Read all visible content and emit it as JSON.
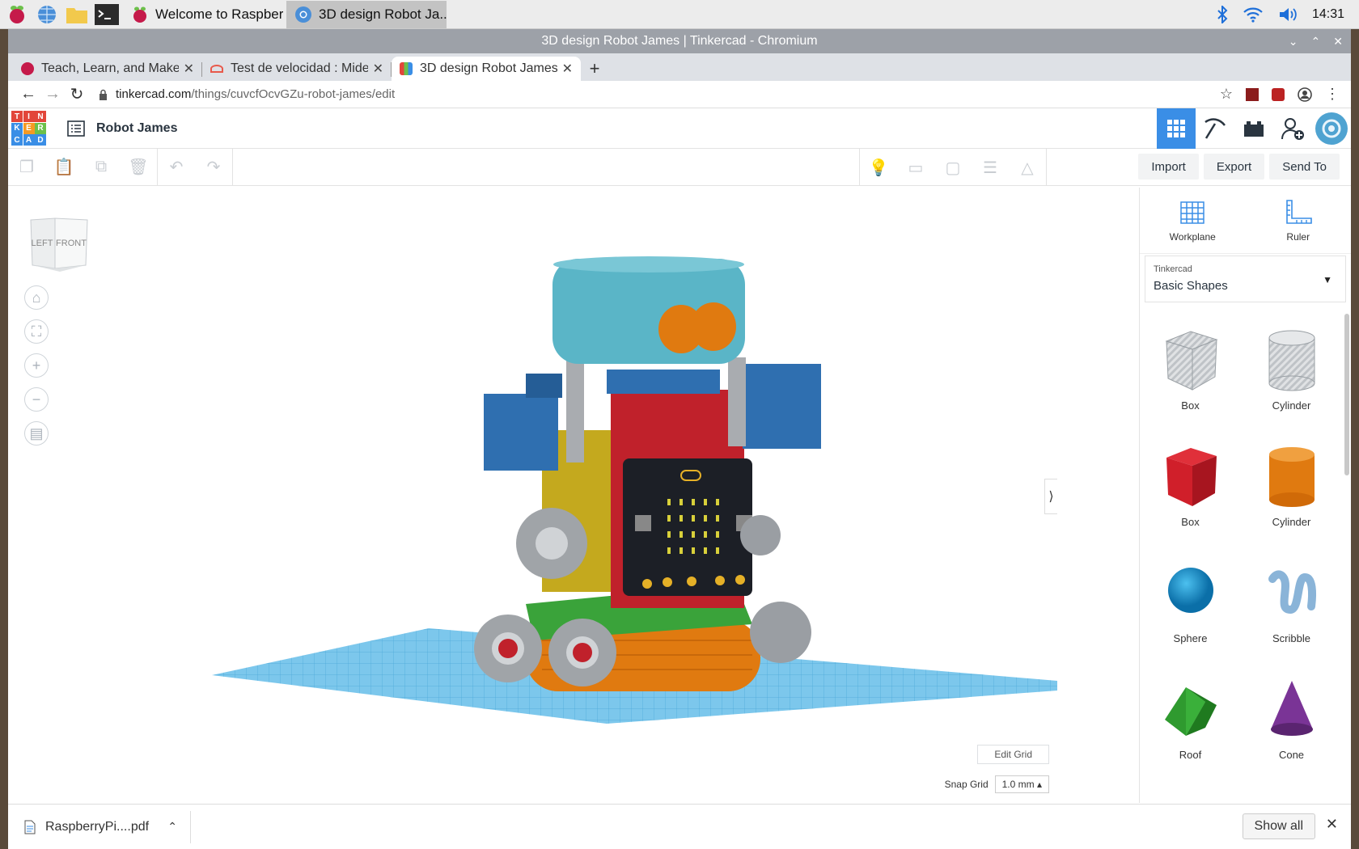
{
  "taskbar": {
    "tasks": [
      {
        "label": "Welcome to Raspberr..."
      },
      {
        "label": "3D design Robot Ja..."
      }
    ],
    "clock": "14:31"
  },
  "window": {
    "title": "3D design Robot James | Tinkercad - Chromium"
  },
  "browser": {
    "tabs": [
      {
        "label": "Teach, Learn, and Make w",
        "favicon_color": "#c51a4a"
      },
      {
        "label": "Test de velocidad : Mide",
        "favicon_color": "#e8594b"
      },
      {
        "label": "3D design Robot James",
        "favicon_color": "#3a8ee6"
      }
    ],
    "url_host": "tinkercad.com",
    "url_path": "/things/cuvcfOcvGZu-robot-james/edit"
  },
  "tinkercad": {
    "logo_letters": [
      "T",
      "I",
      "N",
      "K",
      "E",
      "R",
      "C",
      "A",
      "D"
    ],
    "design_title": "Robot James",
    "actions": {
      "import": "Import",
      "export": "Export",
      "send_to": "Send To"
    },
    "panel": {
      "workplane": "Workplane",
      "ruler": "Ruler",
      "library_owner": "Tinkercad",
      "library_name": "Basic Shapes"
    },
    "shapes": [
      {
        "label": "Box",
        "icon": "box-hole-icon"
      },
      {
        "label": "Cylinder",
        "icon": "cylinder-hole-icon"
      },
      {
        "label": "Box",
        "icon": "box-icon"
      },
      {
        "label": "Cylinder",
        "icon": "cylinder-icon"
      },
      {
        "label": "Sphere",
        "icon": "sphere-icon"
      },
      {
        "label": "Scribble",
        "icon": "scribble-icon"
      },
      {
        "label": "Roof",
        "icon": "roof-icon"
      },
      {
        "label": "Cone",
        "icon": "cone-icon"
      }
    ],
    "viewcube": {
      "left": "LEFT",
      "front": "FRONT"
    },
    "edit_grid": "Edit Grid",
    "snap_grid_label": "Snap Grid",
    "snap_grid_value": "1.0 mm"
  },
  "downloads": {
    "file": "RaspberryPi....pdf",
    "show_all": "Show all"
  }
}
